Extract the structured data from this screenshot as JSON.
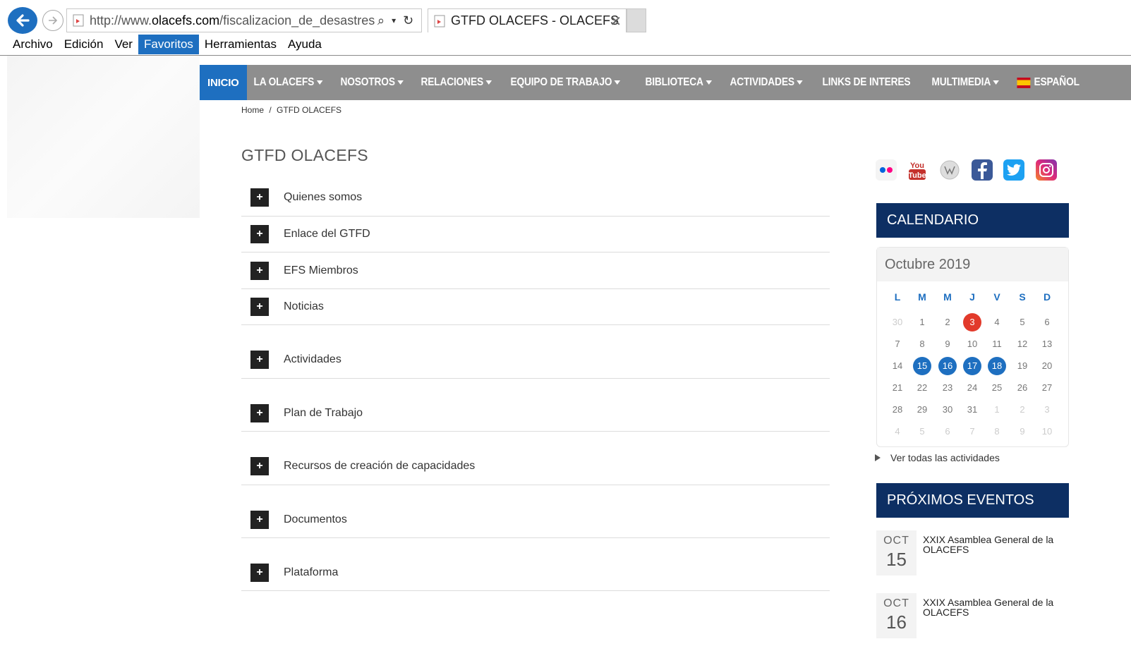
{
  "browser": {
    "url_prefix": "http://www.",
    "url_domain": "olacefs.com",
    "url_path": "/fiscalizacion_de_desastres-g",
    "tab_title": "GTFD OLACEFS - OLACEFS",
    "menu": [
      "Archivo",
      "Edición",
      "Ver",
      "Favoritos",
      "Herramientas",
      "Ayuda"
    ],
    "menu_active": "Favoritos"
  },
  "nav": {
    "items": [
      {
        "label": "INICIO",
        "caret": false
      },
      {
        "label": "LA OLACEFS",
        "caret": true
      },
      {
        "label": "NOSOTROS",
        "caret": true
      },
      {
        "label": "RELACIONES",
        "caret": true
      },
      {
        "label": "EQUIPO DE TRABAJO",
        "caret": true
      },
      {
        "label": "BIBLIOTECA",
        "caret": true
      },
      {
        "label": "ACTIVIDADES",
        "caret": true
      },
      {
        "label": "LINKS DE INTERES",
        "caret": false
      },
      {
        "label": "MULTIMEDIA",
        "caret": true
      },
      {
        "label": "ESPAÑOL",
        "caret": false,
        "flag": true
      }
    ]
  },
  "breadcrumb": {
    "home": "Home",
    "sep": "/",
    "current": "GTFD OLACEFS"
  },
  "page": {
    "title": "GTFD OLACEFS"
  },
  "accordion": [
    {
      "icon": "+",
      "label": "Quienes somos"
    },
    {
      "icon": "+",
      "label": "Enlace del GTFD"
    },
    {
      "icon": "+",
      "label": "EFS Miembros"
    },
    {
      "icon": "+",
      "label": "Noticias"
    },
    {
      "icon": "+",
      "label": "Actividades"
    },
    {
      "icon": "+",
      "label": "Plan de Trabajo"
    },
    {
      "icon": "+",
      "label": "Recursos de creación de capacidades"
    },
    {
      "icon": "+",
      "label": "Documentos"
    },
    {
      "icon": "+",
      "label": "Plataforma"
    }
  ],
  "social": [
    "flickr-icon",
    "youtube-icon",
    "wikipedia-icon",
    "facebook-icon",
    "twitter-icon",
    "instagram-icon"
  ],
  "calendar": {
    "heading": "CALENDARIO",
    "month": "Octubre 2019",
    "dow": [
      "L",
      "M",
      "M",
      "J",
      "V",
      "S",
      "D"
    ],
    "weeks": [
      [
        {
          "d": "30",
          "m": true
        },
        {
          "d": "1"
        },
        {
          "d": "2"
        },
        {
          "d": "3",
          "today": true
        },
        {
          "d": "4"
        },
        {
          "d": "5"
        },
        {
          "d": "6"
        }
      ],
      [
        {
          "d": "7"
        },
        {
          "d": "8"
        },
        {
          "d": "9"
        },
        {
          "d": "10"
        },
        {
          "d": "11"
        },
        {
          "d": "12"
        },
        {
          "d": "13"
        }
      ],
      [
        {
          "d": "14"
        },
        {
          "d": "15",
          "ev": true
        },
        {
          "d": "16",
          "ev": true
        },
        {
          "d": "17",
          "ev": true
        },
        {
          "d": "18",
          "ev": true
        },
        {
          "d": "19"
        },
        {
          "d": "20"
        }
      ],
      [
        {
          "d": "21"
        },
        {
          "d": "22"
        },
        {
          "d": "23"
        },
        {
          "d": "24"
        },
        {
          "d": "25"
        },
        {
          "d": "26"
        },
        {
          "d": "27"
        }
      ],
      [
        {
          "d": "28"
        },
        {
          "d": "29"
        },
        {
          "d": "30"
        },
        {
          "d": "31"
        },
        {
          "d": "1",
          "m": true
        },
        {
          "d": "2",
          "m": true
        },
        {
          "d": "3",
          "m": true
        }
      ],
      [
        {
          "d": "4",
          "m": true
        },
        {
          "d": "5",
          "m": true
        },
        {
          "d": "6",
          "m": true
        },
        {
          "d": "7",
          "m": true
        },
        {
          "d": "8",
          "m": true
        },
        {
          "d": "9",
          "m": true
        },
        {
          "d": "10",
          "m": true
        }
      ]
    ],
    "see_all": "Ver todas las actividades"
  },
  "events": {
    "heading": "PRÓXIMOS EVENTOS",
    "items": [
      {
        "month": "OCT",
        "day": "15",
        "title": "XXIX Asamblea General de la OLACEFS"
      },
      {
        "month": "OCT",
        "day": "16",
        "title": "XXIX Asamblea General de la OLACEFS"
      }
    ]
  },
  "colors": {
    "nav_bg": "#8e8e8e",
    "nav_active": "#1e6fc0",
    "panel_head": "#0d2f63",
    "today": "#e23a2b",
    "event_day": "#1e6fc0"
  }
}
